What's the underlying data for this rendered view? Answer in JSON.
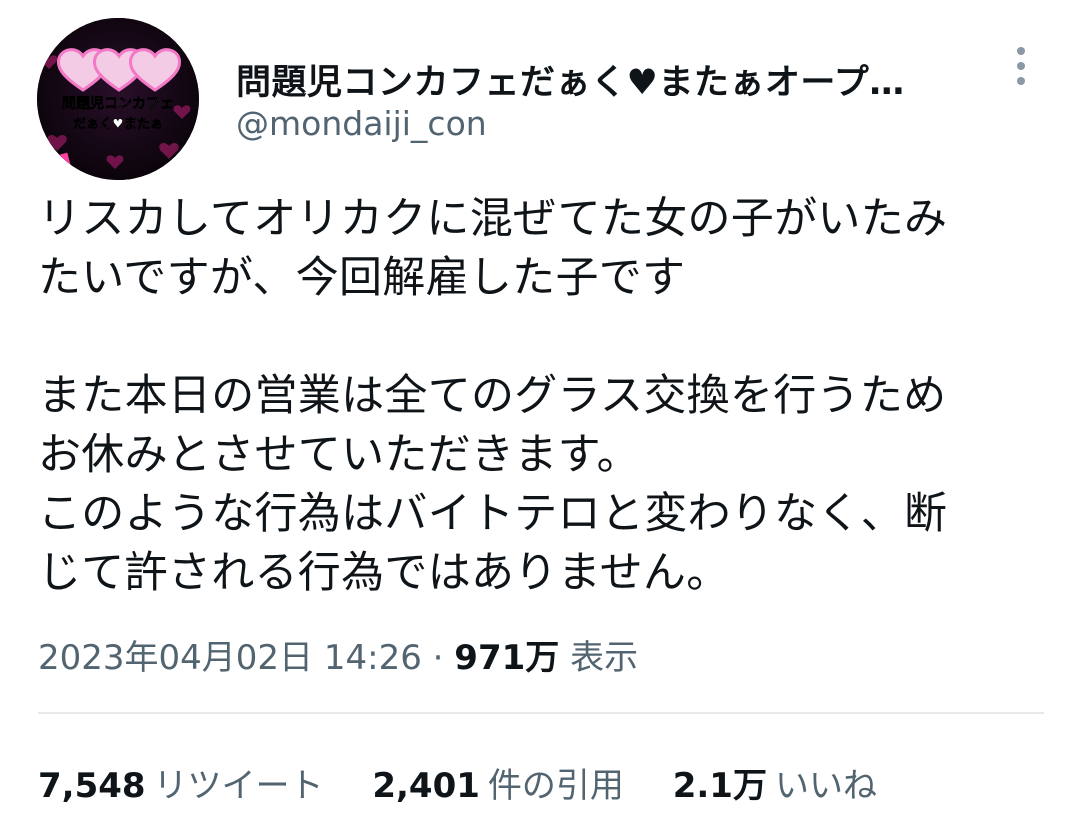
{
  "author": {
    "display_name": "問題児コンカフェだぁく♥またぁオープ…",
    "handle": "@mondaiji_con",
    "avatar_text_line1": "問題児コンカフェ",
    "avatar_text_line2": "だぁく♥またぁ"
  },
  "tweet": {
    "text": "リスカしてオリカクに混ぜてた女の子がいたみ\nたいですが、今回解雇した子です\n\nまた本日の営業は全てのグラス交換を行うため\nお休みとさせていただきます。\nこのような行為はバイトテロと変わりなく、断\nじて許される行為ではありません。",
    "datetime": "2023年04月02日 14:26",
    "separator": "·",
    "views_count": "971万",
    "views_label": "表示"
  },
  "stats": {
    "retweets_count": "7,548",
    "retweets_label": "リツイート",
    "quotes_count": "2,401",
    "quotes_label": "件の引用",
    "likes_count": "2.1万",
    "likes_label": "いいね"
  },
  "colors": {
    "text_primary": "#0f1419",
    "text_secondary": "#536471",
    "divider": "#e7e9ea",
    "avatar_accent": "#ff7fd0"
  },
  "icons": {
    "more": "more-vertical-icon"
  }
}
